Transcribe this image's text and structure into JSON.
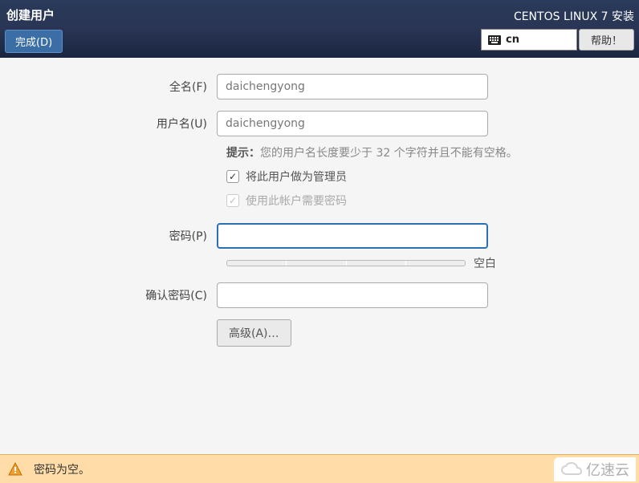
{
  "header": {
    "page_title": "创建用户",
    "done_label": "完成(D)",
    "install_title": "CENTOS LINUX 7 安装",
    "lang_code": "cn",
    "help_label": "帮助！"
  },
  "form": {
    "fullname_label": "全名(F)",
    "fullname_value": "daichengyong",
    "username_label": "用户名(U)",
    "username_value": "daichengyong",
    "hint_label": "提示：",
    "hint_text": "您的用户名长度要少于 32 个字符并且不能有空格。",
    "admin_checkbox_label": "将此用户做为管理员",
    "require_password_label": "使用此帐户需要密码",
    "password_label": "密码(P)",
    "password_value": "",
    "strength_text": "空白",
    "confirm_label": "确认密码(C)",
    "confirm_value": "",
    "advanced_label": "高级(A)…"
  },
  "warning": {
    "message": "密码为空。"
  },
  "watermark": {
    "text": "亿速云"
  }
}
